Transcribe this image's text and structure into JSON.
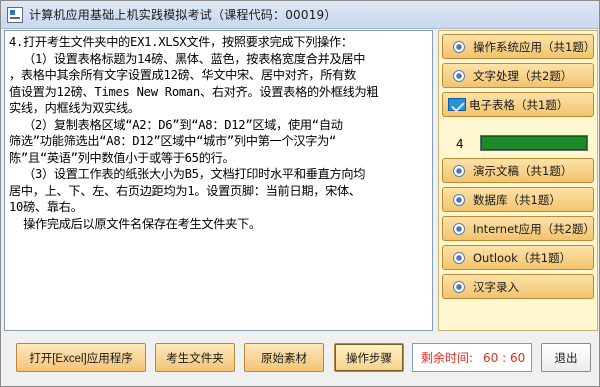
{
  "window": {
    "title": "计算机应用基础上机实践模拟考试（课程代码：00019）"
  },
  "question": {
    "lines": [
      "4.打开考生文件夹中的EX1.XLSX文件，按照要求完成下列操作：",
      "  （1）设置表格标题为14磅、黑体、蓝色，按表格宽度合并及居中",
      "，表格中其余所有文字设置成12磅、华文中宋、居中对齐，所有数",
      "值设置为12磅、Times New Roman、右对齐。设置表格的外框线为粗",
      "实线，内框线为双实线。",
      "  （2）复制表格区域“A2：D6”到“A8：D12”区域，使用“自动",
      "筛选”功能筛选出“A8：D12”区域中“城市”列中第一个汉字为“",
      "陈”且“英语”列中数值小于或等于65的行。",
      "  （3）设置工作表的纸张大小为B5，文档打印时水平和垂直方向均",
      "居中，上、下、左、右页边距均为1。设置页脚：当前日期，宋体、",
      "10磅、靠右。",
      "  操作完成后以原文件名保存在考生文件夹下。"
    ]
  },
  "categories": {
    "items": [
      {
        "label": "操作系统应用（共1题）",
        "icon": "radio-icon"
      },
      {
        "label": "文字处理（共2题）",
        "icon": "radio-icon"
      },
      {
        "label": "电子表格（共1题）",
        "icon": "selected-check-icon"
      },
      {
        "label": "演示文稿（共1题）",
        "icon": "radio-icon"
      },
      {
        "label": "数据库（共1题）",
        "icon": "radio-icon"
      },
      {
        "label": "Internet应用（共2题）",
        "icon": "radio-icon"
      },
      {
        "label": "Outlook（共1题）",
        "icon": "radio-icon"
      },
      {
        "label": "汉字录入",
        "icon": "radio-icon"
      }
    ],
    "progress": {
      "number": "4",
      "fill_fraction": 1.0,
      "fill_color": "#1d8a2a"
    }
  },
  "toolbar": {
    "open_excel": "打开[Excel]应用程序",
    "student_folder": "考生文件夹",
    "original_material": "原始素材",
    "operation_steps": "操作步骤",
    "timer_label": "剩余时间:",
    "timer_value": "60 : 60",
    "exit": "退出"
  },
  "colors": {
    "accent_orange": "#f2c36f",
    "timer_red": "#e0301e",
    "panel_bg": "#fff7d0"
  }
}
